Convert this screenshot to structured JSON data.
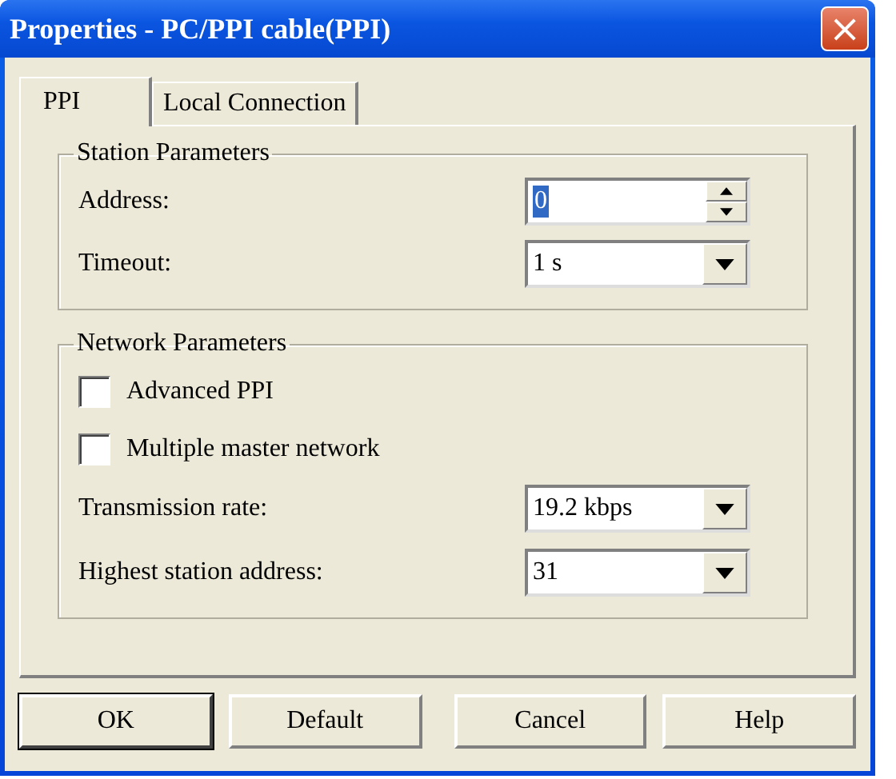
{
  "window": {
    "title": "Properties - PC/PPI cable(PPI)",
    "close": "×"
  },
  "tabs": [
    {
      "label": "PPI",
      "selected": true
    },
    {
      "label": "Local Connection",
      "selected": false
    }
  ],
  "groups": [
    {
      "title": "Station Parameters",
      "rows": [
        {
          "kind": "spin",
          "label": "Address:",
          "value": "0"
        },
        {
          "kind": "dropdown",
          "label": "Timeout:",
          "value": "1 s"
        }
      ]
    },
    {
      "title": "Network Parameters",
      "rows": [
        {
          "kind": "checkbox",
          "label": "Advanced PPI",
          "checked": false
        },
        {
          "kind": "checkbox",
          "label": "Multiple master network",
          "checked": false
        },
        {
          "kind": "dropdown",
          "label": "Transmission rate:",
          "value": "19.2 kbps"
        },
        {
          "kind": "dropdown",
          "label": "Highest station address:",
          "value": "31"
        }
      ]
    }
  ],
  "buttons": [
    {
      "label": "OK",
      "default": true
    },
    {
      "label": "Default",
      "default": false
    },
    {
      "label": "Cancel",
      "default": false
    },
    {
      "label": "Help",
      "default": false
    }
  ]
}
